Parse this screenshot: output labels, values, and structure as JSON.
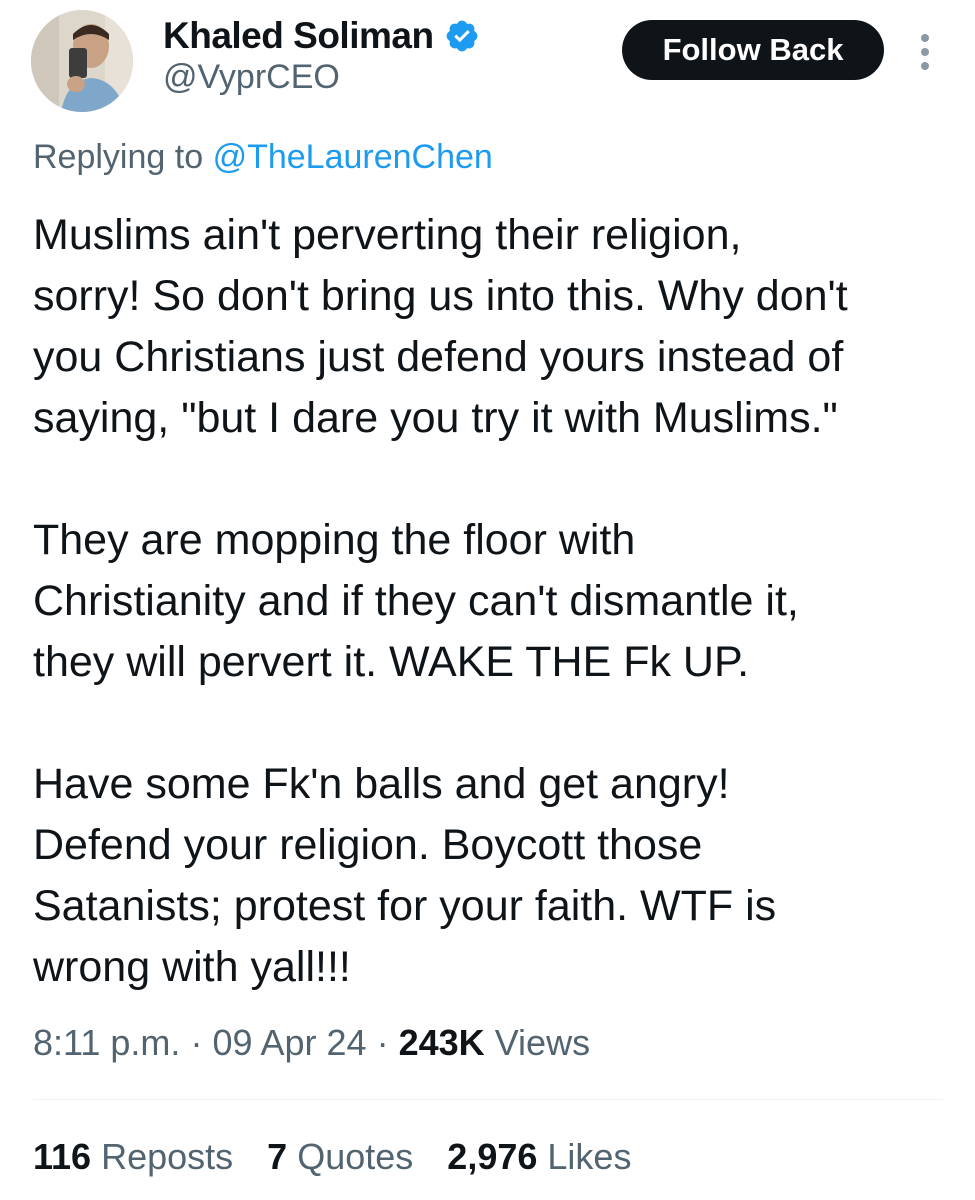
{
  "colors": {
    "text_primary": "#0f1419",
    "text_secondary": "#536471",
    "link": "#1d9bf0",
    "verified": "#1d9bf0",
    "button_bg": "#0f1419",
    "button_text": "#ffffff"
  },
  "author": {
    "display_name": "Khaled Soliman",
    "handle": "@VyprCEO",
    "verified_icon": "verified-badge-icon",
    "avatar_icon": "profile-photo"
  },
  "header": {
    "follow_label": "Follow Back",
    "more_icon": "more-options-icon"
  },
  "reply": {
    "prefix": "Replying to",
    "mention": "@TheLaurenChen"
  },
  "tweet": {
    "paragraphs": [
      {
        "lines": [
          "Muslims ain't perverting their religion,",
          "sorry! So don't bring us into this. Why don't",
          "you Christians just defend yours instead of",
          "saying, \"but I dare you try it with Muslims.\""
        ]
      },
      {
        "lines": [
          "They are mopping the floor with",
          "Christianity and if they can't dismantle it,",
          "they will pervert it. WAKE THE Fk UP."
        ]
      },
      {
        "lines": [
          "Have some Fk'n balls and get angry!",
          "Defend your religion. Boycott those",
          "Satanists; protest for your faith. WTF is",
          "wrong with yall!!!"
        ]
      }
    ]
  },
  "meta": {
    "time": "8:11 p.m.",
    "separator": "·",
    "date": "09 Apr 24",
    "views_count": "243K",
    "views_label": "Views"
  },
  "stats": {
    "reposts_count": "116",
    "reposts_label": "Reposts",
    "quotes_count": "7",
    "quotes_label": "Quotes",
    "likes_count": "2,976",
    "likes_label": "Likes"
  }
}
